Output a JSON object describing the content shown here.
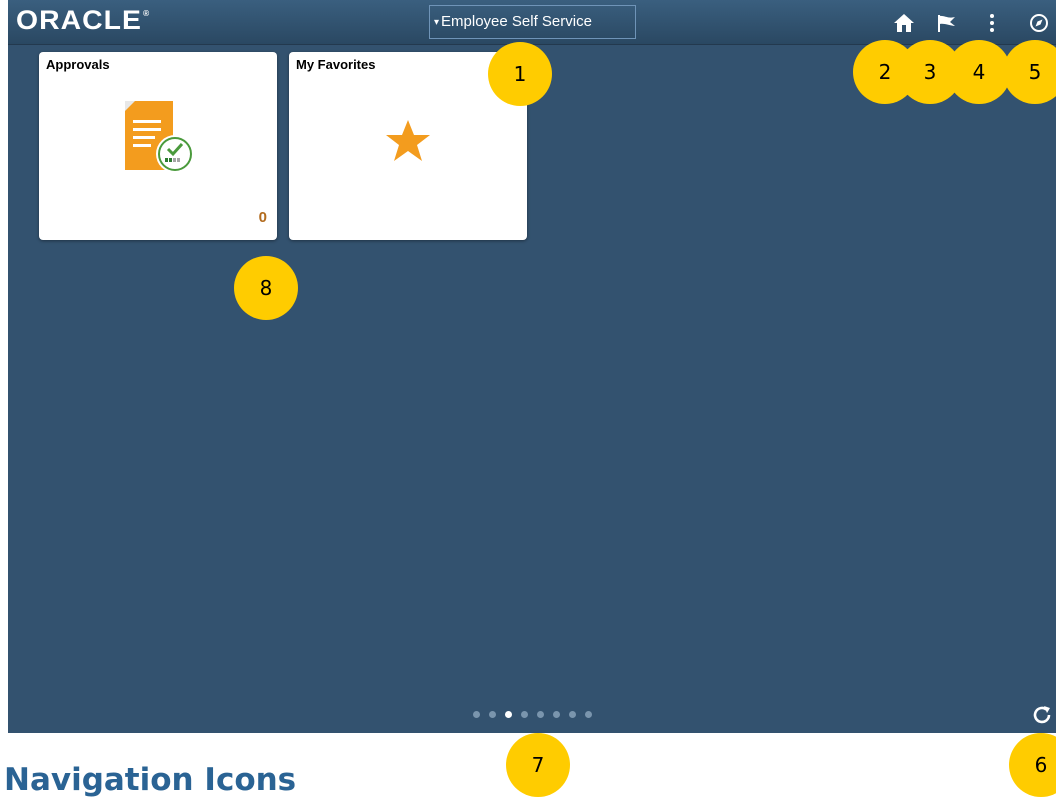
{
  "header": {
    "logo_text": "ORACLE",
    "logo_mark": "®",
    "homepage_selector": {
      "caret": "▾",
      "label": "Employee Self Service"
    },
    "icons": [
      "home-icon",
      "flag-icon",
      "actions-menu-icon",
      "navbar-compass-icon"
    ]
  },
  "tiles": [
    {
      "title": "Approvals",
      "icon": "approvals-document-icon",
      "count": "0"
    },
    {
      "title": "My Favorites",
      "icon": "star-icon"
    }
  ],
  "pagination": {
    "total": 8,
    "active_index": 2
  },
  "refresh_icon": "refresh-icon",
  "callouts": [
    "1",
    "2",
    "3",
    "4",
    "5",
    "6",
    "7",
    "8"
  ],
  "footer_heading": "Navigation Icons",
  "colors": {
    "background": "#33526f",
    "header": "#2f4f6c",
    "tile": "#ffffff",
    "accent_orange": "#f39c1e",
    "callout_yellow": "#ffcc00",
    "heading_blue": "#2a6394"
  }
}
